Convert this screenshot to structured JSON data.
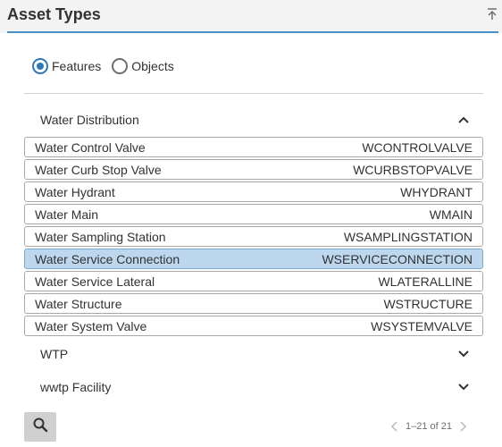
{
  "panel": {
    "title": "Asset Types"
  },
  "radios": [
    {
      "label": "Features",
      "checked": true
    },
    {
      "label": "Objects",
      "checked": false
    }
  ],
  "groups": {
    "water_distribution": {
      "label": "Water Distribution",
      "expanded": true
    },
    "wtp": {
      "label": "WTP",
      "expanded": false
    },
    "wwtp": {
      "label": "wwtp Facility",
      "expanded": false
    }
  },
  "assets": [
    {
      "name": "Water Control Valve",
      "code": "WCONTROLVALVE"
    },
    {
      "name": "Water Curb Stop Valve",
      "code": "WCURBSTOPVALVE"
    },
    {
      "name": "Water Hydrant",
      "code": "WHYDRANT"
    },
    {
      "name": "Water Main",
      "code": "WMAIN"
    },
    {
      "name": "Water Sampling Station",
      "code": "WSAMPLINGSTATION"
    },
    {
      "name": "Water Service Connection",
      "code": "WSERVICECONNECTION",
      "selected": true
    },
    {
      "name": "Water Service Lateral",
      "code": "WLATERALLINE"
    },
    {
      "name": "Water Structure",
      "code": "WSTRUCTURE"
    },
    {
      "name": "Water System Valve",
      "code": "WSYSTEMVALVE"
    }
  ],
  "pager": {
    "text": "1–21 of 21"
  },
  "icons": {
    "collapse": "collapse-panel-icon",
    "chevron_up": "chevron-up-icon",
    "chevron_down": "chevron-down-icon",
    "search": "search-icon",
    "prev": "chevron-left-icon",
    "next": "chevron-right-icon"
  },
  "colors": {
    "accent": "#2e78b7",
    "selected_row": "#bcd7ee",
    "header_line": "#4a90c8"
  }
}
